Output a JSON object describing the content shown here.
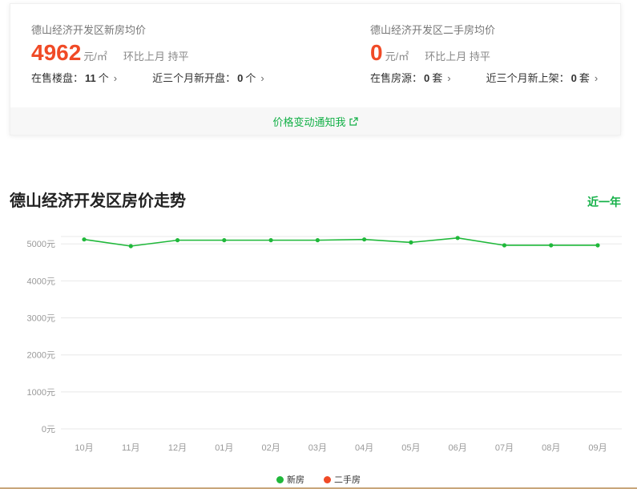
{
  "summary": {
    "new": {
      "title": "德山经济开发区新房均价",
      "price": "4962",
      "unit": "元/㎡",
      "mom": "环比上月 持平",
      "stat1_label": "在售楼盘：",
      "stat1_value": "11",
      "stat1_suffix": "个",
      "stat2_label": "近三个月新开盘：",
      "stat2_value": "0",
      "stat2_suffix": "个"
    },
    "second": {
      "title": "德山经济开发区二手房均价",
      "price": "0",
      "unit": "元/㎡",
      "mom": "环比上月 持平",
      "stat1_label": "在售房源：",
      "stat1_value": "0",
      "stat1_suffix": "套",
      "stat2_label": "近三个月新上架：",
      "stat2_value": "0",
      "stat2_suffix": "套"
    },
    "notify_label": "价格变动通知我"
  },
  "trend": {
    "title": "德山经济开发区房价走势",
    "period": "近一年"
  },
  "legend": {
    "new_label": "新房",
    "second_label": "二手房"
  },
  "colors": {
    "accent_green": "#13b047",
    "price_red": "#f04a26",
    "new_series": "#1fb83a",
    "second_series": "#f04a26"
  },
  "chart_data": {
    "type": "line",
    "categories": [
      "10月",
      "11月",
      "12月",
      "01月",
      "02月",
      "03月",
      "04月",
      "05月",
      "06月",
      "07月",
      "08月",
      "09月"
    ],
    "series": [
      {
        "name": "新房",
        "values": [
          5120,
          4940,
          5100,
          5100,
          5100,
          5100,
          5120,
          5040,
          5160,
          4962,
          4962,
          4962
        ]
      },
      {
        "name": "二手房",
        "values": []
      }
    ],
    "ytick_labels": [
      "0元",
      "1000元",
      "2000元",
      "3000元",
      "4000元",
      "5000元"
    ],
    "ytick_values": [
      0,
      1000,
      2000,
      3000,
      4000,
      5000
    ],
    "ylim": [
      0,
      5200
    ],
    "grid": true,
    "legend_position": "bottom"
  }
}
